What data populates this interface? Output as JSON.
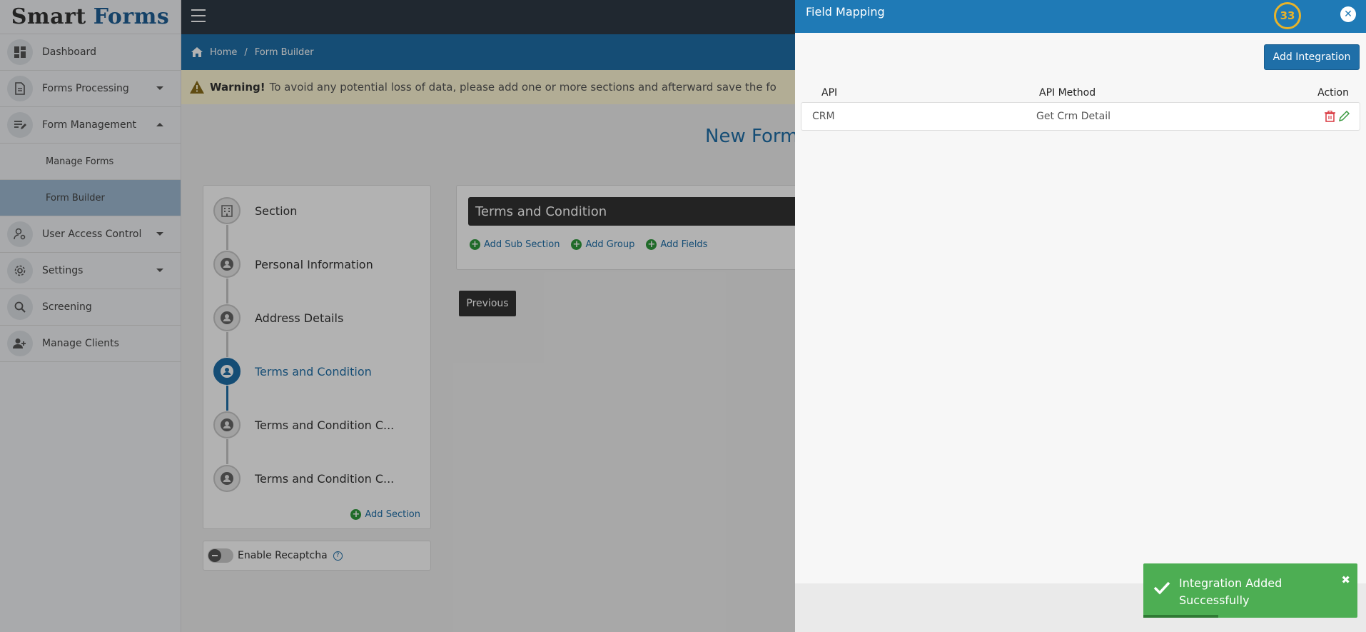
{
  "app": {
    "logo_part1": "Smart",
    "logo_part2": "Forms"
  },
  "sidebar": {
    "items": [
      {
        "label": "Dashboard",
        "icon": "dashboard-icon"
      },
      {
        "label": "Forms Processing",
        "icon": "document-icon"
      },
      {
        "label": "Form Management",
        "icon": "form-edit-icon"
      },
      {
        "label": "User Access Control",
        "icon": "user-gear-icon"
      },
      {
        "label": "Settings",
        "icon": "gear-icon"
      },
      {
        "label": "Screening",
        "icon": "search-icon"
      },
      {
        "label": "Manage Clients",
        "icon": "add-user-icon"
      }
    ],
    "subitems": [
      {
        "label": "Manage Forms"
      },
      {
        "label": "Form Builder"
      }
    ]
  },
  "breadcrumb": {
    "home": "Home",
    "separator": "/",
    "current": "Form Builder"
  },
  "warning": {
    "label": "Warning!",
    "text": "To avoid any potential loss of data, please add one or more sections and afterward save the fo"
  },
  "page_title": "New Form",
  "steps": [
    {
      "label": "Section",
      "icon": "building-icon"
    },
    {
      "label": "Personal Information",
      "icon": "user-icon"
    },
    {
      "label": "Address Details",
      "icon": "user-icon"
    },
    {
      "label": "Terms and Condition",
      "icon": "user-icon"
    },
    {
      "label": "Terms and Condition C...",
      "icon": "user-icon"
    },
    {
      "label": "Terms and Condition C...",
      "icon": "user-icon"
    }
  ],
  "add_section_label": "Add Section",
  "recaptcha_label": "Enable Recaptcha",
  "section_card": {
    "title": "Terms and Condition",
    "add_sub_section": "Add Sub Section",
    "add_group": "Add Group",
    "add_fields": "Add Fields"
  },
  "previous_label": "Previous",
  "drawer": {
    "title": "Field Mapping",
    "timer": "33",
    "add_integration_label": "Add Integration",
    "columns": {
      "api": "API",
      "api_method": "API Method",
      "action": "Action"
    },
    "rows": [
      {
        "api": "CRM",
        "api_method": "Get Crm Detail"
      }
    ]
  },
  "toast": {
    "message": "Integration Added Successfully",
    "close": "✖",
    "progress": 0.35,
    "color": "#4dae53"
  },
  "colors": {
    "primary": "#1f6fa8",
    "drawer_header": "#1f7ab6",
    "topbar": "#2f3a45",
    "warning_bg": "#fff8d6",
    "success": "#4dae53",
    "danger": "#d9363e"
  }
}
